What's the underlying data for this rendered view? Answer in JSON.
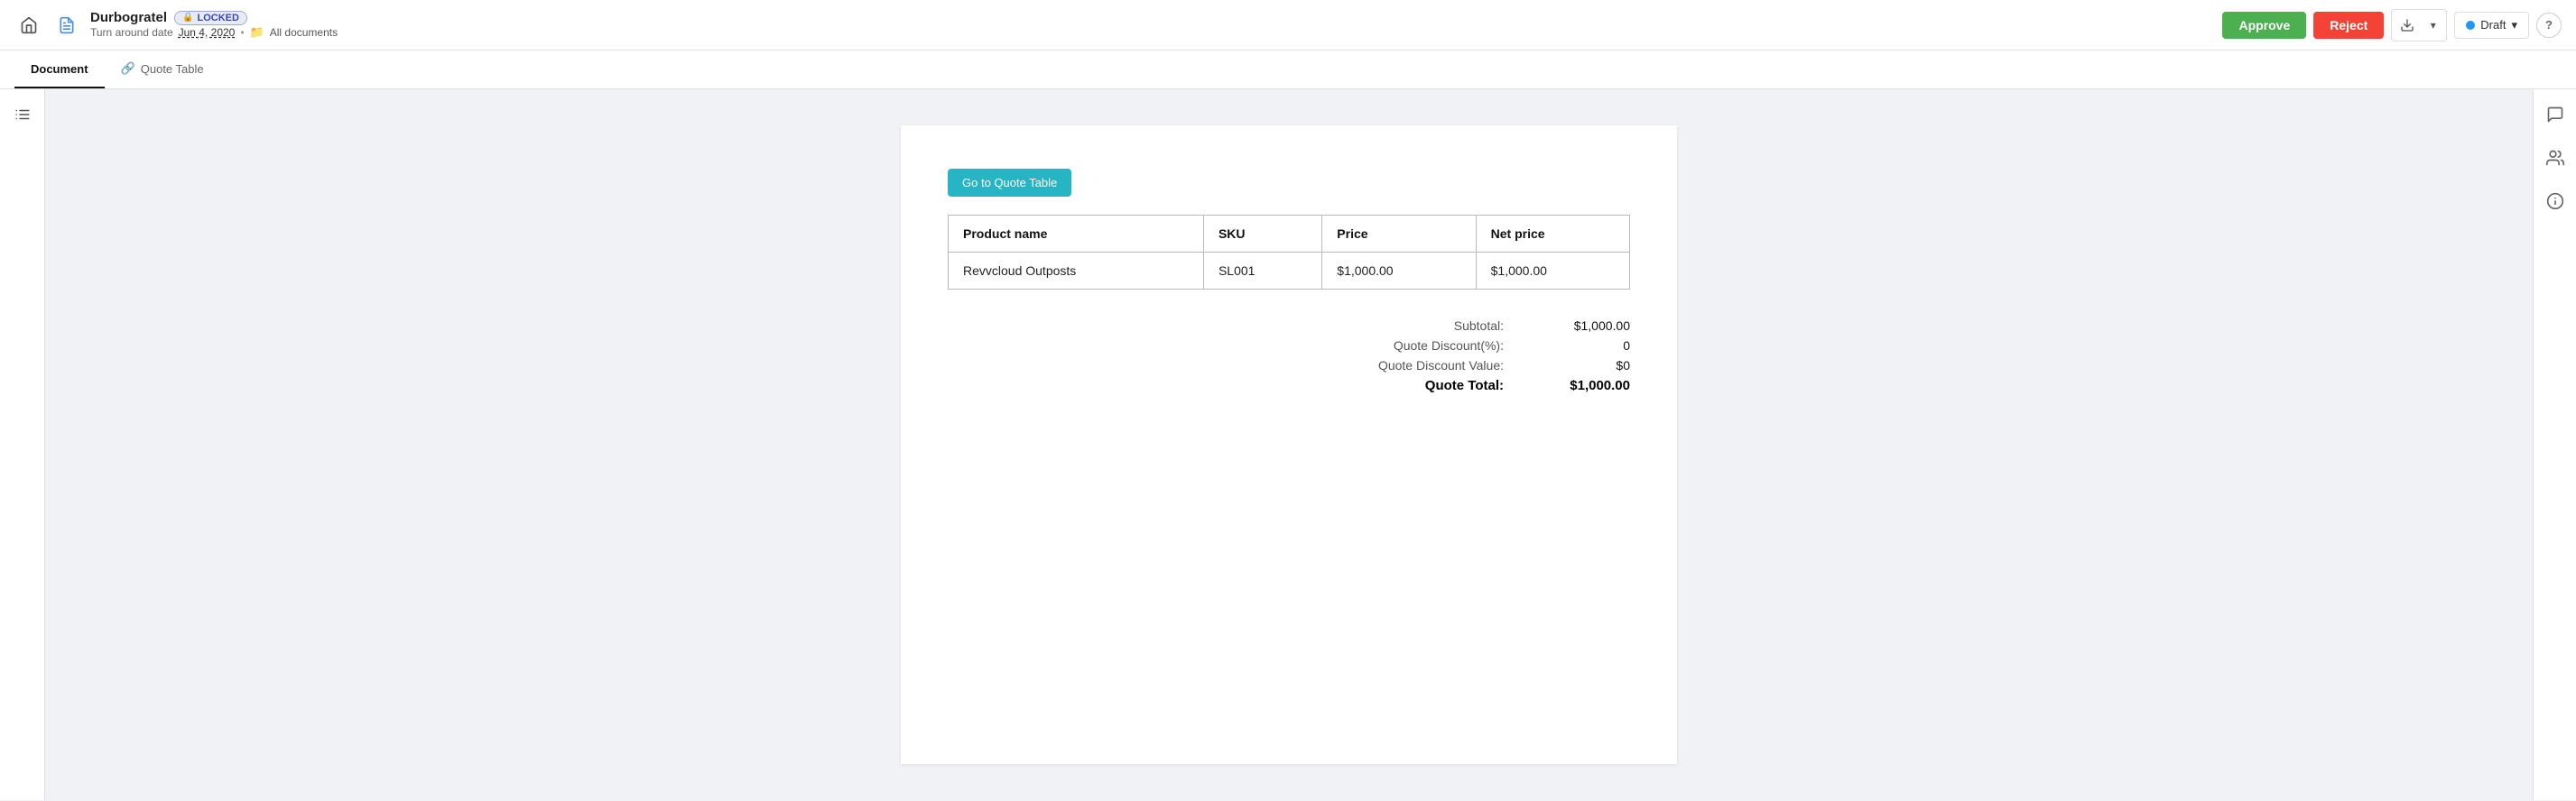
{
  "header": {
    "doc_title": "Durbogratel",
    "locked_label": "LOCKED",
    "turnaround_label": "Turn around date",
    "turnaround_date": "Jun 4, 2020",
    "dot": "•",
    "all_documents": "All documents",
    "approve_label": "Approve",
    "reject_label": "Reject",
    "draft_label": "Draft",
    "help_label": "?"
  },
  "tabs": [
    {
      "id": "document",
      "label": "Document",
      "active": true,
      "icon": ""
    },
    {
      "id": "quote-table",
      "label": "Quote Table",
      "active": false,
      "icon": "🔗"
    }
  ],
  "sidebar": {
    "icons": [
      "☰"
    ]
  },
  "document": {
    "go_to_quote_button": "Go to Quote Table",
    "table": {
      "headers": [
        "Product name",
        "SKU",
        "Price",
        "Net price"
      ],
      "rows": [
        [
          "Revvcloud Outposts",
          "SL001",
          "$1,000.00",
          "$1,000.00"
        ]
      ]
    },
    "totals": [
      {
        "label": "Subtotal:",
        "value": "$1,000.00",
        "bold": false
      },
      {
        "label": "Quote Discount(%):",
        "value": "0",
        "bold": false
      },
      {
        "label": "Quote Discount Value:",
        "value": "$0",
        "bold": false
      },
      {
        "label": "Quote Total:",
        "value": "$1,000.00",
        "bold": true
      }
    ]
  },
  "right_sidebar": {
    "icons": [
      "💬",
      "👤",
      "ℹ️"
    ]
  }
}
